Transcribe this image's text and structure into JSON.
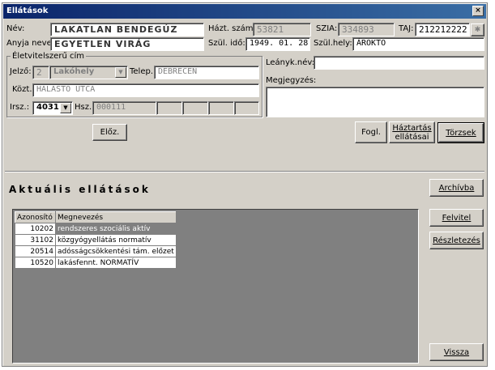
{
  "window": {
    "title": "Ellátások",
    "close_glyph": "×"
  },
  "header": {
    "nev_label": "Név:",
    "nev_value": "LAKATLAN BENDEGÚZ",
    "hazt_label": "Házt. szám:",
    "hazt_value": "53821",
    "szia_label": "SZIA:",
    "szia_value": "334893",
    "taj_label": "TAJ:",
    "taj_value": "212212222",
    "taj_btn": "✱",
    "anyja_label": "Anyja neve:",
    "anyja_value": "EGYETLEN VIRÁG",
    "szulido_label": "Szül. idő:",
    "szulido_value": "1949. 01. 28.",
    "szulhely_label": "Szül.hely:",
    "szulhely_value": "ÁROKTO"
  },
  "address": {
    "group_title": "Életvitelszerű cím",
    "jelzo_label": "Jelző:",
    "jelzo_value": "2",
    "lakohely_value": "Lakóhely",
    "telep_label": "Telep.:",
    "telep_value": "DEBRECEN",
    "kozt_label": "Közt.:",
    "kozt_value": "HALASTO UTCA",
    "irsz_label": "Irsz.:",
    "irsz_value": "4031",
    "hsz_label": "Hsz.:",
    "hsz_value": "000111"
  },
  "right_panel": {
    "leanyk_label": "Leányk.név:",
    "leanyk_value": "",
    "megj_label": "Megjegyzés:",
    "megj_value": ""
  },
  "actions": {
    "eloz_label": "Előz.",
    "fogl_label": "Fogl.",
    "haztartas_line1": "Háztartás",
    "haztartas_line2": "ellátásai",
    "torzsek_label": "Törzsek"
  },
  "services": {
    "title": "Aktuális ellátások",
    "columns": [
      "Azonosító",
      "Megnevezés"
    ],
    "rows": [
      {
        "id": "10202",
        "name": "rendszeres szociális aktív"
      },
      {
        "id": "31102",
        "name": "közgyógyellátás normatív"
      },
      {
        "id": "20514",
        "name": "adósságcsökkentési tám. előzet"
      },
      {
        "id": "10520",
        "name": "lakásfennt. NORMATÍV"
      }
    ],
    "archivba_label": "Archívba",
    "felvitel_label": "Felvitel",
    "reszletezes_label": "Részletezés",
    "vissza_label": "Vissza"
  }
}
